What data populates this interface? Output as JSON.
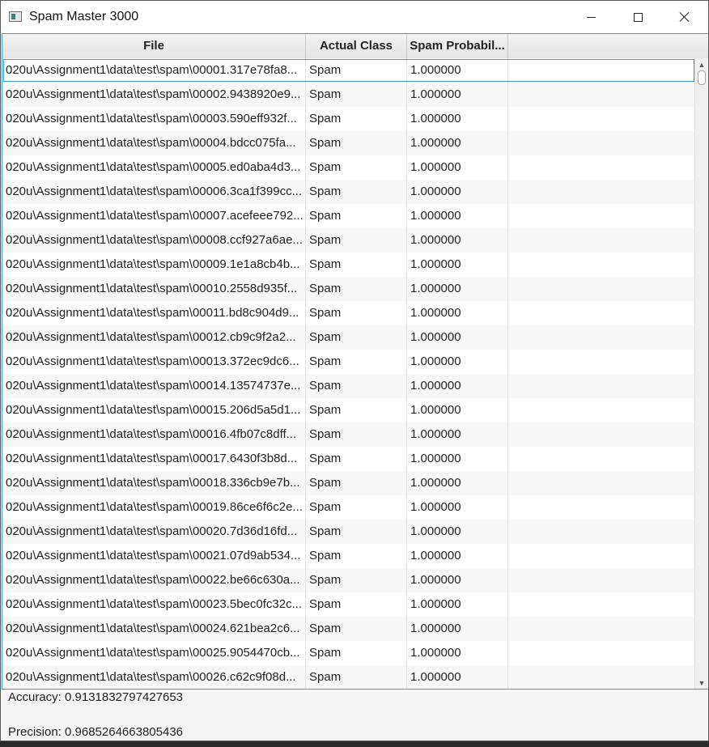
{
  "window": {
    "title": "Spam Master 3000",
    "icon": "app-window-icon"
  },
  "table": {
    "columns": [
      "File",
      "Actual Class",
      "Spam Probabil..."
    ],
    "rows": [
      {
        "file": "020u\\Assignment1\\data\\test\\spam\\00001.317e78fa8...",
        "class": "Spam",
        "prob": "1.000000"
      },
      {
        "file": "020u\\Assignment1\\data\\test\\spam\\00002.9438920e9...",
        "class": "Spam",
        "prob": "1.000000"
      },
      {
        "file": "020u\\Assignment1\\data\\test\\spam\\00003.590eff932f...",
        "class": "Spam",
        "prob": "1.000000"
      },
      {
        "file": "020u\\Assignment1\\data\\test\\spam\\00004.bdcc075fa...",
        "class": "Spam",
        "prob": "1.000000"
      },
      {
        "file": "020u\\Assignment1\\data\\test\\spam\\00005.ed0aba4d3...",
        "class": "Spam",
        "prob": "1.000000"
      },
      {
        "file": "020u\\Assignment1\\data\\test\\spam\\00006.3ca1f399cc...",
        "class": "Spam",
        "prob": "1.000000"
      },
      {
        "file": "020u\\Assignment1\\data\\test\\spam\\00007.acefeee792...",
        "class": "Spam",
        "prob": "1.000000"
      },
      {
        "file": "020u\\Assignment1\\data\\test\\spam\\00008.ccf927a6ae...",
        "class": "Spam",
        "prob": "1.000000"
      },
      {
        "file": "020u\\Assignment1\\data\\test\\spam\\00009.1e1a8cb4b...",
        "class": "Spam",
        "prob": "1.000000"
      },
      {
        "file": "020u\\Assignment1\\data\\test\\spam\\00010.2558d935f...",
        "class": "Spam",
        "prob": "1.000000"
      },
      {
        "file": "020u\\Assignment1\\data\\test\\spam\\00011.bd8c904d9...",
        "class": "Spam",
        "prob": "1.000000"
      },
      {
        "file": "020u\\Assignment1\\data\\test\\spam\\00012.cb9c9f2a2...",
        "class": "Spam",
        "prob": "1.000000"
      },
      {
        "file": "020u\\Assignment1\\data\\test\\spam\\00013.372ec9dc6...",
        "class": "Spam",
        "prob": "1.000000"
      },
      {
        "file": "020u\\Assignment1\\data\\test\\spam\\00014.13574737e...",
        "class": "Spam",
        "prob": "1.000000"
      },
      {
        "file": "020u\\Assignment1\\data\\test\\spam\\00015.206d5a5d1...",
        "class": "Spam",
        "prob": "1.000000"
      },
      {
        "file": "020u\\Assignment1\\data\\test\\spam\\00016.4fb07c8dff...",
        "class": "Spam",
        "prob": "1.000000"
      },
      {
        "file": "020u\\Assignment1\\data\\test\\spam\\00017.6430f3b8d...",
        "class": "Spam",
        "prob": "1.000000"
      },
      {
        "file": "020u\\Assignment1\\data\\test\\spam\\00018.336cb9e7b...",
        "class": "Spam",
        "prob": "1.000000"
      },
      {
        "file": "020u\\Assignment1\\data\\test\\spam\\00019.86ce6f6c2e...",
        "class": "Spam",
        "prob": "1.000000"
      },
      {
        "file": "020u\\Assignment1\\data\\test\\spam\\00020.7d36d16fd...",
        "class": "Spam",
        "prob": "1.000000"
      },
      {
        "file": "020u\\Assignment1\\data\\test\\spam\\00021.07d9ab534...",
        "class": "Spam",
        "prob": "1.000000"
      },
      {
        "file": "020u\\Assignment1\\data\\test\\spam\\00022.be66c630a...",
        "class": "Spam",
        "prob": "1.000000"
      },
      {
        "file": "020u\\Assignment1\\data\\test\\spam\\00023.5bec0fc32c...",
        "class": "Spam",
        "prob": "1.000000"
      },
      {
        "file": "020u\\Assignment1\\data\\test\\spam\\00024.621bea2c6...",
        "class": "Spam",
        "prob": "1.000000"
      },
      {
        "file": "020u\\Assignment1\\data\\test\\spam\\00025.9054470cb...",
        "class": "Spam",
        "prob": "1.000000"
      },
      {
        "file": "020u\\Assignment1\\data\\test\\spam\\00026.c62c9f08d...",
        "class": "Spam",
        "prob": "1.000000"
      }
    ]
  },
  "stats": {
    "accuracy": "Accuracy:  0.9131832797427653",
    "precision": "Precision: 0.9685264663805436"
  }
}
